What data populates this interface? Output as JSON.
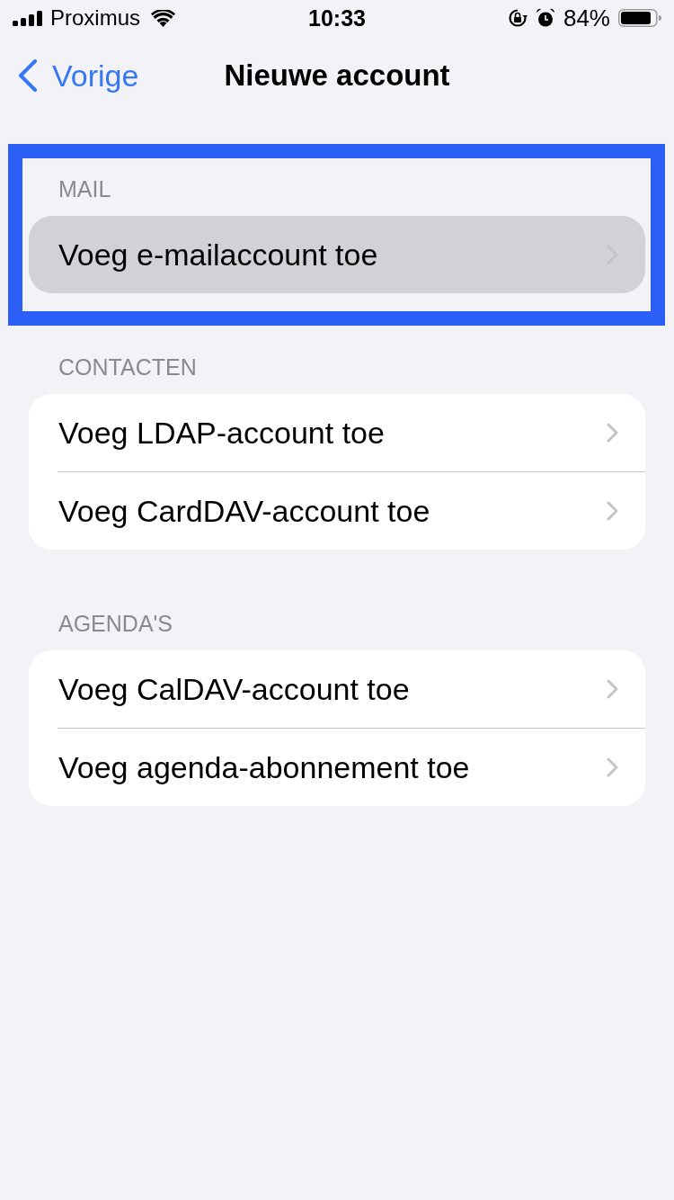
{
  "status_bar": {
    "carrier": "Proximus",
    "time": "10:33",
    "battery": "84%"
  },
  "nav": {
    "back": "Vorige",
    "title": "Nieuwe account"
  },
  "sections": [
    {
      "header": "MAIL",
      "highlighted": true,
      "rows": [
        {
          "label": "Voeg e-mailaccount toe",
          "selected": true
        }
      ]
    },
    {
      "header": "CONTACTEN",
      "highlighted": false,
      "rows": [
        {
          "label": "Voeg LDAP-account toe",
          "selected": false
        },
        {
          "label": "Voeg CardDAV-account toe",
          "selected": false
        }
      ]
    },
    {
      "header": "AGENDA'S",
      "highlighted": false,
      "rows": [
        {
          "label": "Voeg CalDAV-account toe",
          "selected": false
        },
        {
          "label": "Voeg agenda-abonnement toe",
          "selected": false
        }
      ]
    }
  ]
}
